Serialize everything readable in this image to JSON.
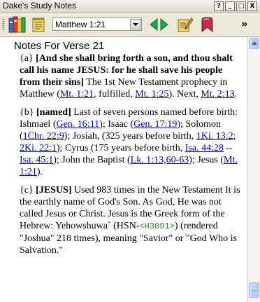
{
  "window": {
    "title": "Dake's Study Notes",
    "controls": [
      "?",
      "_",
      "□",
      "X"
    ]
  },
  "toolbar": {
    "verse_select_value": "Matthew 1:21",
    "more_glyph": "»"
  },
  "notes": {
    "heading": "Notes For Verse 21",
    "a": {
      "marker": "{a}",
      "quote": "[And she shall bring forth a son, and thou shalt call his name JESUS: for he shall save his people from their sins]",
      "text1": "The 1st New Testament prophecy in Matthew (",
      "link1": "Mt. 1:21",
      "text2": ", fulfilled, ",
      "link2": "Mt. 1:25",
      "text3": "). Next, ",
      "link3": "Mt. 2:13",
      "text4": "."
    },
    "b": {
      "marker": "{b}",
      "keyword": "[named]",
      "t1": "Last of seven persons named before birth: Ishmael (",
      "l1": "Gen. 16:11",
      "t2": "); Isaac (",
      "l2": "Gen. 17:19",
      "t3": "); Solomon (",
      "l3": "1Chr. 22:9",
      "t4": "); Josiah, (325 years before birth, ",
      "l4": "1Ki. 13:2",
      "t5": "; ",
      "l5": "2Ki. 22:1",
      "t6": "); Cyrus (175 years before birth, ",
      "l6": "Isa. 44:28",
      "t7": " -- ",
      "l7": "Isa. 45:1",
      "t8": "); John the Baptist (",
      "l8": "Lk. 1:13,60-63",
      "t9": "); Jesus (",
      "l9": "Mt. 1:21",
      "t10": ")."
    },
    "c": {
      "marker": "{c}",
      "keyword": "[JESUS]",
      "t1": "Used 983 times in the New Testament It is the earthly name of God's Son. As God, He was not called Jesus or Christ. Jesus is the Greek form of the Hebrew: Yehowshuwa` (HSN-",
      "strong": "<H3091>",
      "t2": ") (rendered \"Joshua\" 218 times), meaning \"Savior\" or \"God Who is Salvation.\""
    }
  },
  "colors": {
    "link": "#0000d0",
    "strong_ref": "#2a8a2a",
    "arrow_green": "#1aa64a",
    "bookmark_red": "#c0304a"
  }
}
